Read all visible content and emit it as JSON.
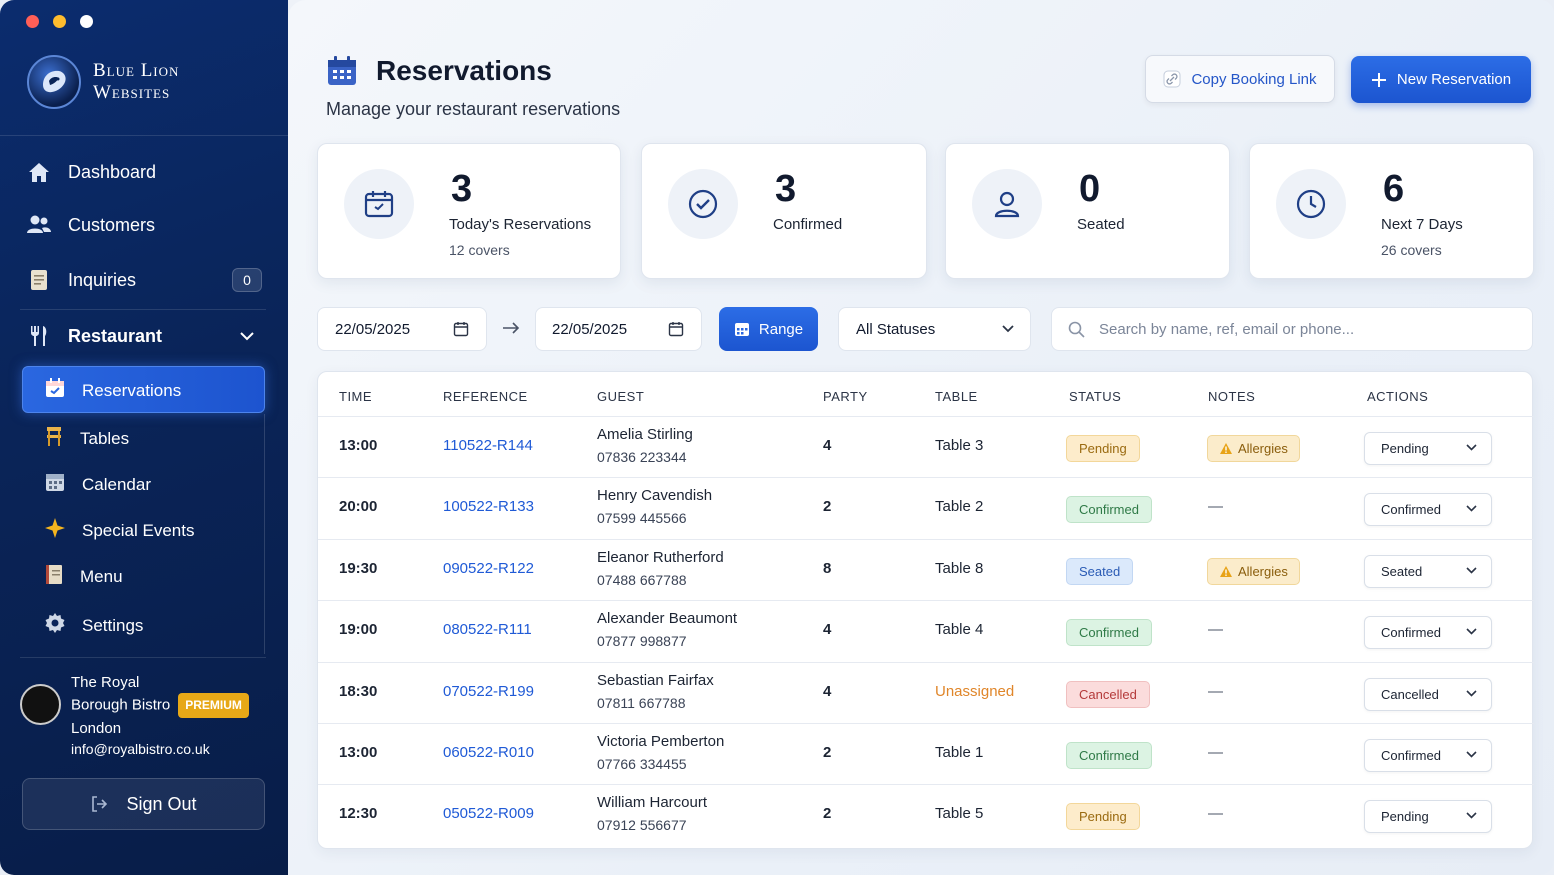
{
  "window": {
    "dots": [
      "#ff5f57",
      "#febc2e",
      "#ffffff"
    ]
  },
  "brand": {
    "line1": "Blue Lion",
    "line2": "Websites"
  },
  "nav": {
    "dashboard": "Dashboard",
    "customers": "Customers",
    "inquiries": "Inquiries",
    "inquiries_count": "0",
    "restaurant": "Restaurant",
    "sub": [
      "Reservations",
      "Tables",
      "Calendar",
      "Special Events",
      "Menu",
      "Settings"
    ]
  },
  "profile": {
    "name_line1": "The Royal",
    "name_line2": "Borough Bistro",
    "name_line3": "London",
    "badge": "PREMIUM",
    "email": "info@royalbistro.co.uk"
  },
  "signout": "Sign Out",
  "page": {
    "title": "Reservations",
    "subtitle": "Manage your restaurant reservations",
    "copy_link": "Copy Booking Link",
    "new_reservation": "New Reservation"
  },
  "stats": [
    {
      "value": "3",
      "label": "Today's Reservations",
      "covers": "12 covers"
    },
    {
      "value": "3",
      "label": "Confirmed",
      "covers": ""
    },
    {
      "value": "0",
      "label": "Seated",
      "covers": ""
    },
    {
      "value": "6",
      "label": "Next 7 Days",
      "covers": "26 covers"
    }
  ],
  "filters": {
    "date_from": "22/05/2025",
    "date_to": "22/05/2025",
    "range": "Range",
    "status": "All Statuses",
    "search_placeholder": "Search by name, ref, email or phone..."
  },
  "columns": [
    "TIME",
    "REFERENCE",
    "GUEST",
    "PARTY",
    "TABLE",
    "STATUS",
    "NOTES",
    "ACTIONS"
  ],
  "rows": [
    {
      "time": "13:00",
      "ref": "110522-R144",
      "name": "Amelia Stirling",
      "phone": "07836 223344",
      "party": "4",
      "table": "Table 3",
      "status": "Pending",
      "notes": "Allergies",
      "action": "Pending"
    },
    {
      "time": "20:00",
      "ref": "100522-R133",
      "name": "Henry Cavendish",
      "phone": "07599 445566",
      "party": "2",
      "table": "Table 2",
      "status": "Confirmed",
      "notes": "—",
      "action": "Confirmed"
    },
    {
      "time": "19:30",
      "ref": "090522-R122",
      "name": "Eleanor Rutherford",
      "phone": "07488 667788",
      "party": "8",
      "table": "Table 8",
      "status": "Seated",
      "notes": "Allergies",
      "action": "Seated"
    },
    {
      "time": "19:00",
      "ref": "080522-R111",
      "name": "Alexander Beaumont",
      "phone": "07877 998877",
      "party": "4",
      "table": "Table 4",
      "status": "Confirmed",
      "notes": "—",
      "action": "Confirmed"
    },
    {
      "time": "18:30",
      "ref": "070522-R199",
      "name": "Sebastian Fairfax",
      "phone": "07811 667788",
      "party": "4",
      "table": "Unassigned",
      "status": "Cancelled",
      "notes": "—",
      "action": "Cancelled"
    },
    {
      "time": "13:00",
      "ref": "060522-R010",
      "name": "Victoria Pemberton",
      "phone": "07766 334455",
      "party": "2",
      "table": "Table 1",
      "status": "Confirmed",
      "notes": "—",
      "action": "Confirmed"
    },
    {
      "time": "12:30",
      "ref": "050522-R009",
      "name": "William Harcourt",
      "phone": "07912 556677",
      "party": "2",
      "table": "Table 5",
      "status": "Pending",
      "notes": "—",
      "action": "Pending"
    }
  ],
  "colors": {
    "accent": "#1f5ad6",
    "sidebar": "#0a2458",
    "pending_bg": "#fdeccb",
    "confirmed_bg": "#dcf3e3",
    "seated_bg": "#dbe9fb",
    "cancelled_bg": "#fbdcdc",
    "unassigned": "#e0862a"
  }
}
